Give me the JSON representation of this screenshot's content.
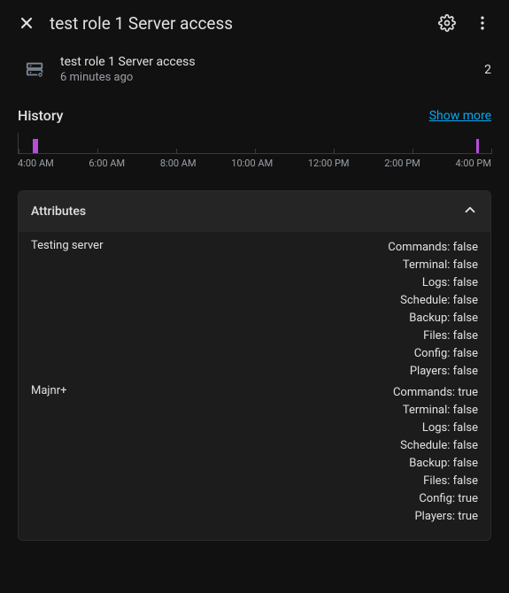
{
  "header": {
    "title": "test role 1 Server access"
  },
  "info": {
    "title": "test role 1 Server access",
    "subtitle": "6 minutes ago",
    "count": "2"
  },
  "history": {
    "title": "History",
    "show_more": "Show more",
    "ticks": [
      "4:00 AM",
      "6:00 AM",
      "8:00 AM",
      "10:00 AM",
      "12:00 PM",
      "2:00 PM",
      "4:00 PM"
    ]
  },
  "attributes": {
    "title": "Attributes",
    "groups": [
      {
        "name": "Testing server",
        "lines": [
          "Commands: false",
          "Terminal: false",
          "Logs: false",
          "Schedule: false",
          "Backup: false",
          "Files: false",
          "Config: false",
          "Players: false"
        ]
      },
      {
        "name": "Majnr+",
        "lines": [
          "Commands: true",
          "Terminal: false",
          "Logs: false",
          "Schedule: false",
          "Backup: false",
          "Files: false",
          "Config: true",
          "Players: true"
        ]
      }
    ]
  }
}
